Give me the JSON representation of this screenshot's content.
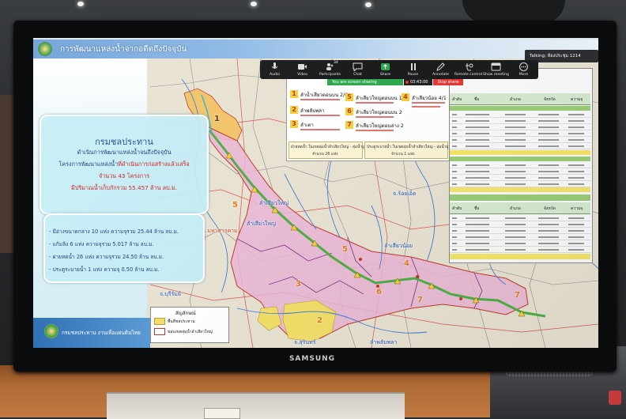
{
  "zoom": {
    "talking": "Talking: ห้องประชุม 1214",
    "participants_count": "34",
    "toolbar": [
      {
        "label": "Audio",
        "icon": "microphone-icon"
      },
      {
        "label": "Video",
        "icon": "camera-icon"
      },
      {
        "label": "Participants",
        "icon": "participants-icon"
      },
      {
        "label": "Chat",
        "icon": "chat-icon"
      },
      {
        "label": "Share",
        "icon": "share-screen-icon"
      },
      {
        "label": "Pause",
        "icon": "pause-icon"
      },
      {
        "label": "Annotate",
        "icon": "pencil-icon"
      },
      {
        "label": "Remote control",
        "icon": "remote-control-icon"
      },
      {
        "label": "Show meeting",
        "icon": "window-icon"
      },
      {
        "label": "More",
        "icon": "more-dots-icon"
      }
    ],
    "sharing_text": "You are screen sharing",
    "timer": "03:43:00",
    "stop_share": "Stop share"
  },
  "slide": {
    "title": "การพัฒนาแหล่งน้ำจากอดีตถึงปัจจุบัน",
    "summary_card": {
      "org": "กรมชลประทาน",
      "line1": "ดำเนินการพัฒนาแหล่งน้ำจนถึงปัจจุบัน",
      "line2_a": "โครงการพัฒนาแหล่งน้ำ",
      "line2_b": "ที่ดำเนินการก่อสร้างแล้วเสร็จ",
      "line3": "จำนวน 43 โครงการ",
      "line4": "มีปริมาณน้ำเก็บกักรวม 55.457 ล้าน ลบ.ม."
    },
    "detail_card": [
      "- มีอ่างขนาดกลาง 10 แห่ง ความจุรวม 25.44 ล้าน ลบ.ม.",
      "- แก้มลิง 6 แห่ง ความจุรวม 5.017 ล้าน ลบ.ม.",
      "- ฝายทดน้ำ 26 แห่ง ความจุรวม 24.50 ล้าน ลบ.ม.",
      "- ประตูระบายน้ำ 1 แห่ง ความจุ 0.50 ล้าน ลบ.ม."
    ],
    "footer": "กรมชลประทาน งานเพื่อแผ่นดินไทย",
    "legend": {
      "title": "สัญลักษณ์",
      "items": [
        "พื้นที่ชลประทาน",
        "ขอบเขตลุ่มน้ำลำเสียวใหญ่"
      ]
    },
    "map_labels": {
      "mahasarakham": "จ.มหาสารคาม",
      "river_main_1": "ลำเสียวใหญ่",
      "river_main_2": "ลำเสียวใหญ่",
      "roiet": "จ.ร้อยเอ็ด",
      "river_noi": "ลำเสียวน้อย",
      "buriram": "จ.บุรีรัมย์",
      "surin": "จ.สุรินทร์",
      "phlapphla": "ลำพลับพลา"
    },
    "map_numbers": [
      "1",
      "5",
      "5",
      "4",
      "3",
      "6",
      "7",
      "7",
      "2"
    ],
    "basins": [
      {
        "no": "1",
        "name": "ลำน้ำเสียวตอนบน 2/6"
      },
      {
        "no": "2",
        "name": "ลำพลับพลา"
      },
      {
        "no": "3",
        "name": "ลำเตา"
      },
      {
        "no": "5",
        "name": "ลำเสียวใหญ่ตอนบน 1"
      },
      {
        "no": "6",
        "name": "ลำเสียวใหญ่ตอนบน 2"
      },
      {
        "no": "7",
        "name": "ลำเสียวใหญ่ตอนล่าง 2"
      },
      {
        "no": "4",
        "name": "ลำเสียวน้อย 4/1"
      }
    ],
    "structure_boxes": [
      {
        "title": "ฝายทดน้ำ ในเขตลุ่มน้ำลำเสียวใหญ่ - ลุ่มน้ำมูล",
        "count": "จำนวน 26 แห่ง"
      },
      {
        "title": "ประตูระบายน้ำ ในเขตลุ่มน้ำลำเสียวใหญ่ - ลุ่มน้ำมูล",
        "count": "จำนวน 1 แห่ง"
      }
    ],
    "table": {
      "headers": [
        "ลำดับ",
        "ชื่อ",
        "อำเภอ",
        "จังหวัด",
        "ความจุ"
      ]
    }
  },
  "monitor": {
    "brand": "SAMSUNG"
  },
  "colors": {
    "header_blue": "#6c9fd6",
    "card_cyan": "#c4ecf6",
    "basin_pink": "#e9b6d6",
    "irrigation_yellow": "#f2df6a",
    "river_green": "#4fae45",
    "zoom_share_green": "#2fa84f",
    "stop_red": "#e53935"
  }
}
